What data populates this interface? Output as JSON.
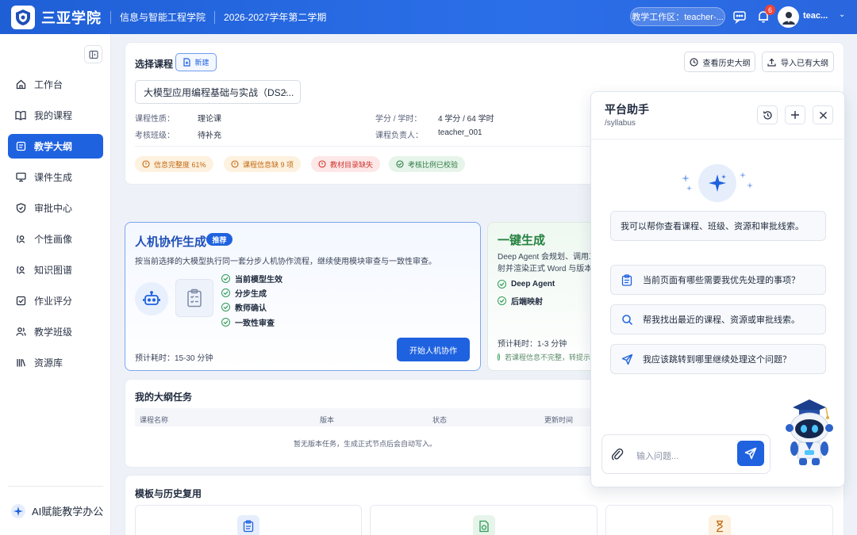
{
  "header": {
    "brand": "三亚学院",
    "college": "信息与智能工程学院",
    "semester": "2026-2027学年第二学期",
    "workspace": "教学工作区：teacher-...",
    "notification_count": "6",
    "username": "teac..."
  },
  "sidebar": {
    "items": [
      {
        "label": "工作台",
        "icon": "home-icon"
      },
      {
        "label": "我的课程",
        "icon": "book-icon"
      },
      {
        "label": "教学大纲",
        "icon": "syllabus-icon",
        "active": true
      },
      {
        "label": "课件生成",
        "icon": "monitor-icon"
      },
      {
        "label": "审批中心",
        "icon": "shield-icon"
      },
      {
        "label": "个性画像",
        "icon": "profile-icon"
      },
      {
        "label": "知识图谱",
        "icon": "graph-icon"
      },
      {
        "label": "作业评分",
        "icon": "checkbox-icon"
      },
      {
        "label": "教学班级",
        "icon": "users-icon"
      },
      {
        "label": "资源库",
        "icon": "library-icon"
      }
    ],
    "footer": "AI赋能教学办公"
  },
  "course": {
    "section_title": "选择课程",
    "new_label": "新建",
    "history_label": "查看历史大纲",
    "import_label": "导入已有大纲",
    "selected": "大模型应用编程基础与实战（DS2...",
    "fields": {
      "nature_label": "课程性质：",
      "nature_value": "理论课",
      "credit_label": "学分 / 学时：",
      "credit_value": "4 学分 / 64 学时",
      "class_label": "考核班级：",
      "class_value": "待补充",
      "owner_label": "课程负责人：",
      "owner_value": "teacher_001"
    },
    "chips": [
      "信息完整度 61%",
      "课程信息缺 9 项",
      "教材目录缺失",
      "考核比例已校验"
    ]
  },
  "hero_collab": {
    "title": "人机协作生成",
    "badge": "推荐",
    "desc": "按当前选择的大模型执行同一套分步人机协作流程，继续使用模块审查与一致性审查。",
    "steps": [
      "当前模型生效",
      "分步生成",
      "教师确认",
      "一致性审查"
    ],
    "eta": "预计耗时：15-30 分钟",
    "button": "开始人机协作"
  },
  "hero_auto": {
    "title": "一键生成",
    "desc1": "Deep Agent 会规划、调用工",
    "desc2": "射并渲染正式 Word 与版本记",
    "steps": [
      "Deep Agent",
      "后端映射"
    ],
    "eta": "预计耗时：1-3 分钟",
    "note": "若课程信息不完整，转提示"
  },
  "tasks": {
    "title": "我的大纲任务",
    "columns": [
      "课程名称",
      "版本",
      "状态",
      "更新时间"
    ],
    "empty": "暂无版本任务，生成正式节点后会自动写入。"
  },
  "templates": {
    "title": "模板与历史复用"
  },
  "assistant": {
    "title": "平台助手",
    "subtitle": "/syllabus",
    "greeting": "我可以帮你查看课程、班级、资源和审批线索。",
    "suggestions": [
      {
        "text": "当前页面有哪些需要我优先处理的事项？",
        "icon": "clipboard-icon"
      },
      {
        "text": "帮我找出最近的课程、资源或审批线索。",
        "icon": "search-icon"
      },
      {
        "text": "我应该跳转到哪里继续处理这个问题？",
        "icon": "send-icon"
      }
    ],
    "input_placeholder": "输入问题..."
  },
  "colors": {
    "primary": "#1f62e0",
    "success": "#2f9b57",
    "warning": "#c26a12",
    "danger": "#d0342c"
  }
}
